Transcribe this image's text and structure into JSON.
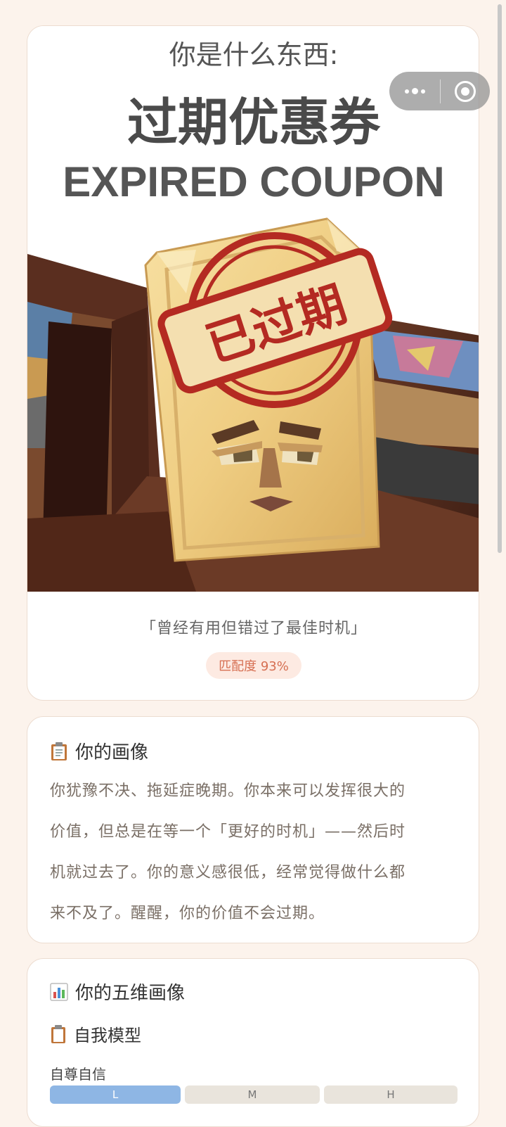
{
  "hero": {
    "kicker": "你是什么东西:",
    "title_cn": "过期优惠券",
    "title_en": "EXPIRED COUPON",
    "stamp_text": "已过期",
    "quote": "「曾经有用但错过了最佳时机」",
    "match_label": "匹配度 93%"
  },
  "portrait": {
    "icon": "clipboard-icon",
    "title": "你的画像",
    "lines": [
      "你犹豫不决、拖延症晚期。你本来可以发挥很大的",
      "价值，但总是在等一个「更好的时机」——然后时",
      "机就过去了。你的意义感很低，经常觉得做什么都",
      "来不及了。醒醒，你的价值不会过期。"
    ]
  },
  "five_dim": {
    "icon": "bar-chart-icon",
    "title": "你的五维画像",
    "sub_icon": "clipboard-icon",
    "sub_title": "自我模型",
    "dimension": "自尊自信",
    "levels": [
      "L",
      "M",
      "H"
    ],
    "active_level": "L"
  },
  "colors": {
    "background": "#fcf3ec",
    "match_text": "#d66f52",
    "active_level": "#8eb6e4"
  }
}
